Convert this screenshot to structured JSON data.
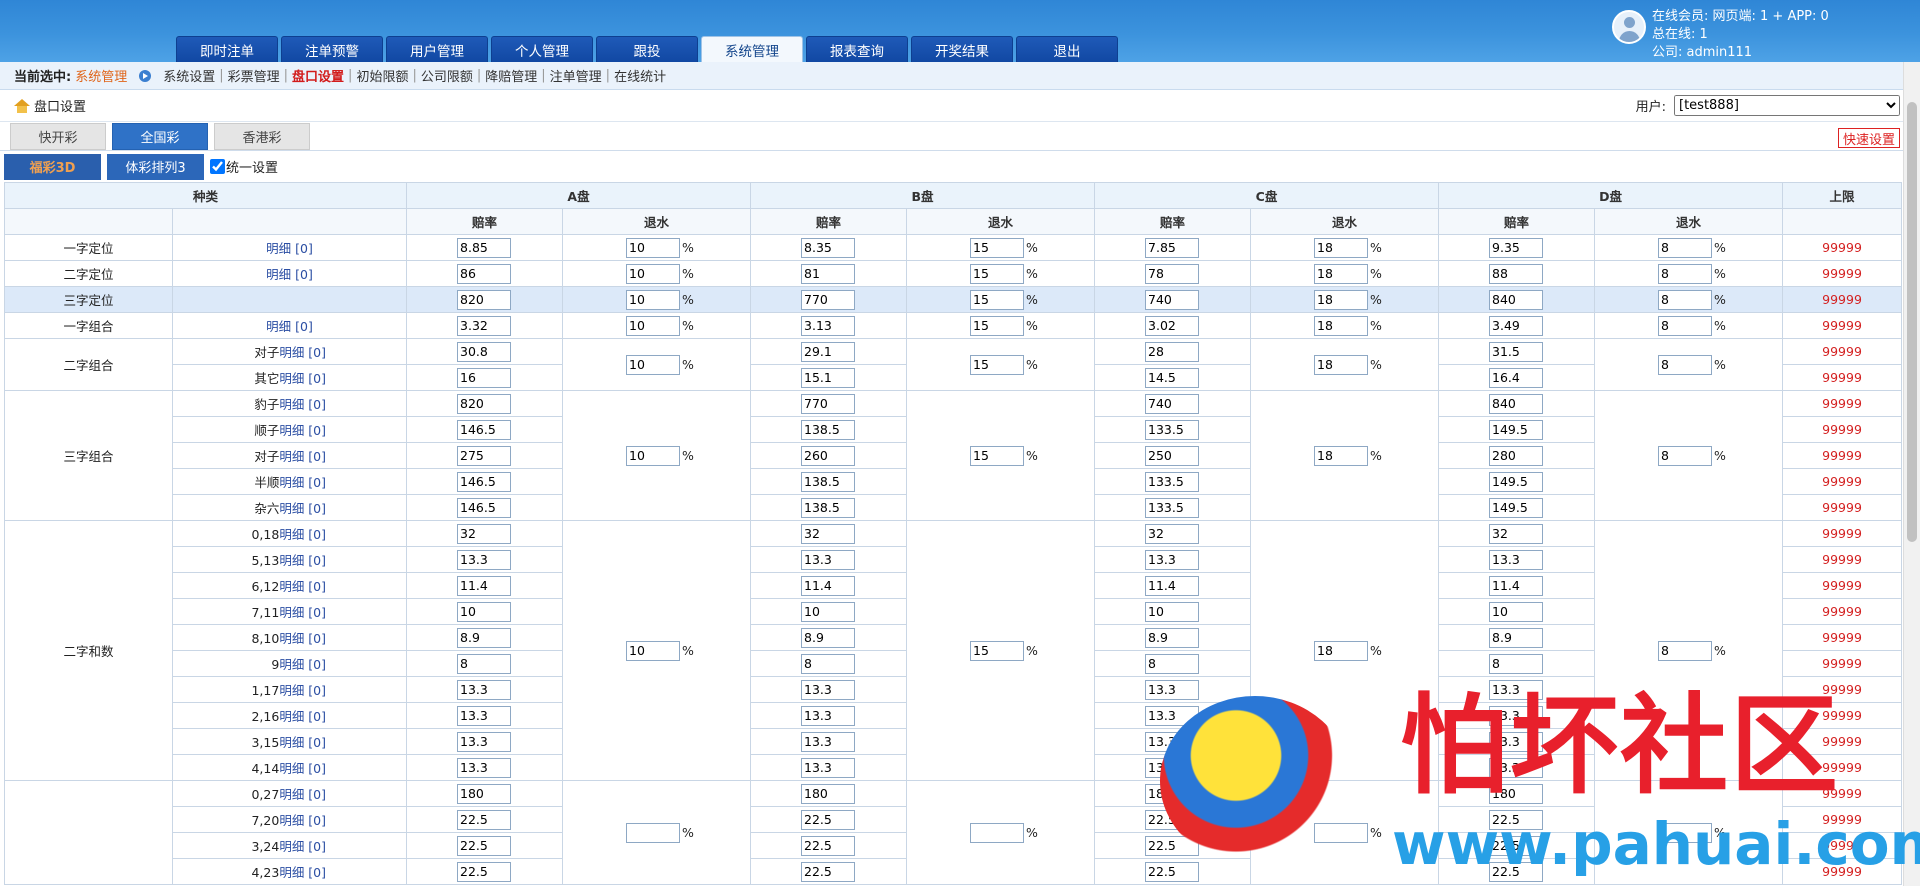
{
  "header": {
    "tabs": [
      "即时注单",
      "注单预警",
      "用户管理",
      "个人管理",
      "跟投",
      "系统管理",
      "报表查询",
      "开奖结果",
      "退出"
    ],
    "active_tab_index": 5,
    "online_line": "在线会员:  网页端: 1 + APP: 0",
    "total_line": "总在线: 1",
    "company_line": "公司: admin111"
  },
  "crumb": {
    "prefix": "当前选中:",
    "current": "系统管理",
    "links": [
      "系统设置",
      "彩票管理",
      "盘口设置",
      "初始限额",
      "公司限额",
      "降赔管理",
      "注单管理",
      "在线统计"
    ],
    "selected_index": 2
  },
  "title": {
    "label": "盘口设置",
    "user_label": "用户:",
    "user_value": "[test888]"
  },
  "lottery_tabs": [
    "快开彩",
    "全国彩",
    "香港彩"
  ],
  "lottery_active": 1,
  "quick_set": "快速设置",
  "sub_tabs": [
    "福彩3D",
    "体彩排列3"
  ],
  "sub_active": 0,
  "unify_label": "统一设置",
  "table": {
    "head1": [
      "种类",
      "A盘",
      "B盘",
      "C盘",
      "D盘",
      "上限"
    ],
    "head2": [
      "赔率",
      "退水",
      "赔率",
      "退水",
      "赔率",
      "退水",
      "赔率",
      "退水"
    ],
    "pct": "%",
    "rows": [
      {
        "cat": "一字定位",
        "sub": "",
        "link": "明细 [0]",
        "odds": [
          "8.85",
          "8.35",
          "7.85",
          "9.35"
        ],
        "rebate": [
          "10",
          "15",
          "18",
          "8"
        ],
        "limit": "99999"
      },
      {
        "cat": "二字定位",
        "sub": "",
        "link": "明细 [0]",
        "odds": [
          "86",
          "81",
          "78",
          "88"
        ],
        "rebate": [
          "10",
          "15",
          "18",
          "8"
        ],
        "limit": "99999"
      },
      {
        "cat": "三字定位",
        "sub": "",
        "link": "",
        "odds": [
          "820",
          "770",
          "740",
          "840"
        ],
        "rebate": [
          "10",
          "15",
          "18",
          "8"
        ],
        "limit": "99999"
      },
      {
        "cat": "一字组合",
        "sub": "",
        "link": "明细 [0]",
        "odds": [
          "3.32",
          "3.13",
          "3.02",
          "3.49"
        ],
        "rebate": [
          "10",
          "15",
          "18",
          "8"
        ],
        "limit": "99999"
      },
      {
        "cat": "二字组合",
        "sub": "对子",
        "link": "明细 [0]",
        "odds": [
          "30.8",
          "29.1",
          "28",
          "31.5"
        ],
        "rebate": [
          "10",
          "15",
          "18",
          "8"
        ],
        "limit": "99999"
      },
      {
        "cat": "",
        "sub": "其它",
        "link": "明细 [0]",
        "odds": [
          "16",
          "15.1",
          "14.5",
          "16.4"
        ],
        "limit": "99999"
      },
      {
        "cat": "三字组合",
        "sub": "豹子",
        "link": "明细 [0]",
        "odds": [
          "820",
          "770",
          "740",
          "840"
        ],
        "limit": "99999"
      },
      {
        "cat": "",
        "sub": "顺子",
        "link": "明细 [0]",
        "odds": [
          "146.5",
          "138.5",
          "133.5",
          "149.5"
        ],
        "limit": "99999"
      },
      {
        "cat": "",
        "sub": "对子",
        "link": "明细 [0]",
        "odds": [
          "275",
          "260",
          "250",
          "280"
        ],
        "rebate": [
          "10",
          "15",
          "18",
          "8"
        ],
        "limit": "99999"
      },
      {
        "cat": "",
        "sub": "半顺",
        "link": "明细 [0]",
        "odds": [
          "146.5",
          "138.5",
          "133.5",
          "149.5"
        ],
        "limit": "99999"
      },
      {
        "cat": "",
        "sub": "杂六",
        "link": "明细 [0]",
        "odds": [
          "146.5",
          "138.5",
          "133.5",
          "149.5"
        ],
        "limit": "99999"
      },
      {
        "cat": "二字和数",
        "sub": "0,18",
        "link": "明细 [0]",
        "odds": [
          "32",
          "32",
          "32",
          "32"
        ],
        "limit": "99999"
      },
      {
        "cat": "",
        "sub": "5,13",
        "link": "明细 [0]",
        "odds": [
          "13.3",
          "13.3",
          "13.3",
          "13.3"
        ],
        "limit": "99999"
      },
      {
        "cat": "",
        "sub": "6,12",
        "link": "明细 [0]",
        "odds": [
          "11.4",
          "11.4",
          "11.4",
          "11.4"
        ],
        "limit": "99999"
      },
      {
        "cat": "",
        "sub": "7,11",
        "link": "明细 [0]",
        "odds": [
          "10",
          "10",
          "10",
          "10"
        ],
        "limit": "99999"
      },
      {
        "cat": "",
        "sub": "8,10",
        "link": "明细 [0]",
        "odds": [
          "8.9",
          "8.9",
          "8.9",
          "8.9"
        ],
        "limit": "99999"
      },
      {
        "cat": "",
        "sub": "9",
        "link": "明细 [0]",
        "odds": [
          "8",
          "8",
          "8",
          "8"
        ],
        "rebate": [
          "10",
          "15",
          "18",
          "8"
        ],
        "limit": "99999"
      },
      {
        "cat": "",
        "sub": "1,17",
        "link": "明细 [0]",
        "odds": [
          "13.3",
          "13.3",
          "13.3",
          "13.3"
        ],
        "limit": "99999"
      },
      {
        "cat": "",
        "sub": "2,16",
        "link": "明细 [0]",
        "odds": [
          "13.3",
          "13.3",
          "13.3",
          "13.3"
        ],
        "limit": "99999"
      },
      {
        "cat": "",
        "sub": "3,15",
        "link": "明细 [0]",
        "odds": [
          "13.3",
          "13.3",
          "13.3",
          "13.3"
        ],
        "limit": "99999"
      },
      {
        "cat": "",
        "sub": "4,14",
        "link": "明细 [0]",
        "odds": [
          "13.3",
          "13.3",
          "13.3",
          "13.3"
        ],
        "limit": "99999"
      },
      {
        "cat": "",
        "sub": "0,27",
        "link": "明细 [0]",
        "odds": [
          "180",
          "180",
          "180",
          "180"
        ],
        "limit": "99999"
      },
      {
        "cat": "",
        "sub": "7,20",
        "link": "明细 [0]",
        "odds": [
          "22.5",
          "22.5",
          "22.5",
          "22.5"
        ],
        "limit": "99999"
      },
      {
        "cat": "",
        "sub": "3,24",
        "link": "明细 [0]",
        "odds": [
          "22.5",
          "22.5",
          "22.5",
          "22.5"
        ],
        "limit": "99999"
      },
      {
        "cat": "",
        "sub": "4,23",
        "link": "明细 [0]",
        "odds": [
          "22.5",
          "22.5",
          "22.5",
          "22.5"
        ],
        "limit": "99999"
      }
    ]
  },
  "watermark": {
    "title": "怕坏社区",
    "url": "www.pahuai.com"
  }
}
